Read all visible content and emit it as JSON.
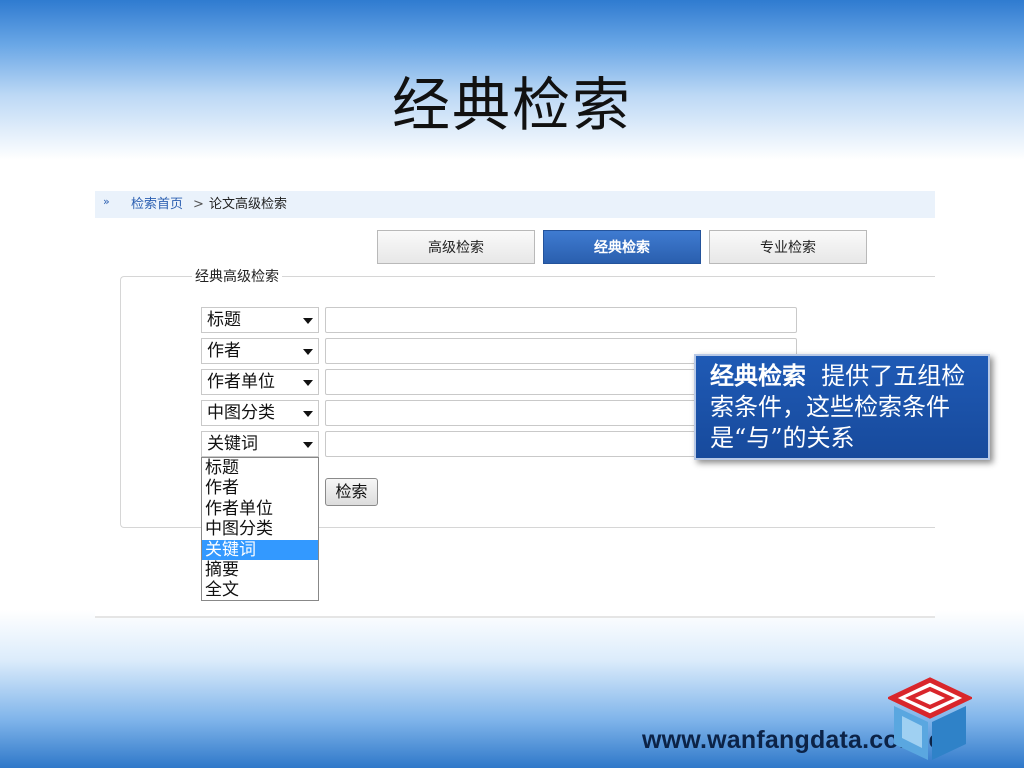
{
  "slide": {
    "title": "经典检索",
    "footer_url": "www.wanfangdata.com.cn"
  },
  "breadcrumb": {
    "chevron": "»",
    "home": "检索首页",
    "separator": ">",
    "current": "论文高级检索"
  },
  "tabs": [
    {
      "label": "高级检索",
      "active": false
    },
    {
      "label": "经典检索",
      "active": true
    },
    {
      "label": "专业检索",
      "active": false
    }
  ],
  "form": {
    "legend": "经典高级检索",
    "rows": [
      {
        "field": "标题",
        "value": ""
      },
      {
        "field": "作者",
        "value": ""
      },
      {
        "field": "作者单位",
        "value": ""
      },
      {
        "field": "中图分类",
        "value": ""
      },
      {
        "field": "关键词",
        "value": ""
      }
    ],
    "dropdown_options": [
      "标题",
      "作者",
      "作者单位",
      "中图分类",
      "关键词",
      "摘要",
      "全文"
    ],
    "dropdown_selected": "关键词",
    "search_button": "检索"
  },
  "callout": {
    "bold": "经典检索",
    "text": "提供了五组检索条件，这些检索条件是“与”的关系"
  },
  "colors": {
    "active_tab": "#2a5fae",
    "highlight": "#3399ff",
    "callout_bg": "#1f5ab5"
  }
}
